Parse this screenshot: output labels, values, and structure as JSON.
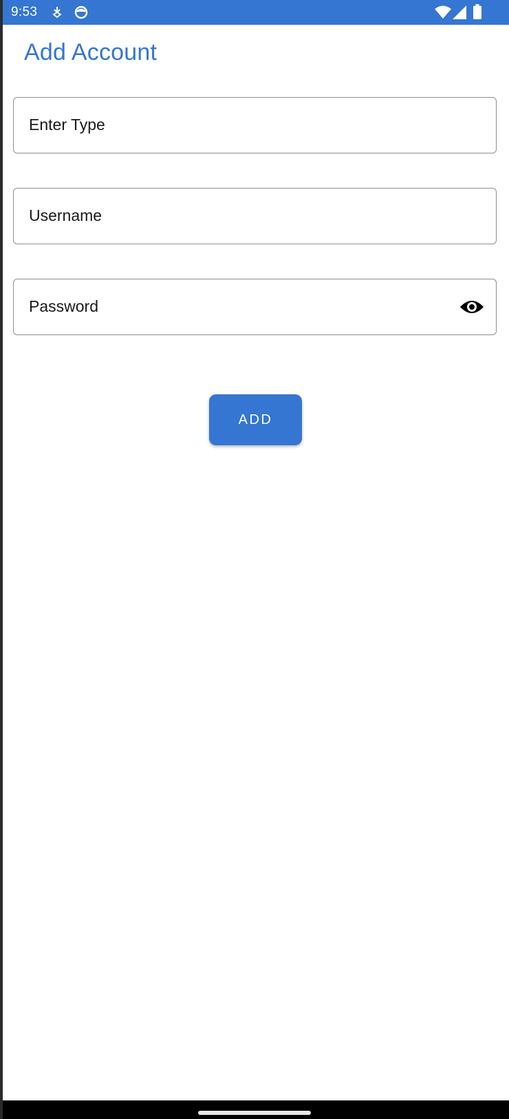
{
  "status_bar": {
    "time": "9:53",
    "icons": [
      "download-notification-icon",
      "app-notification-icon",
      "wifi-icon",
      "signal-icon",
      "battery-icon"
    ],
    "color": "#3476d1"
  },
  "header": {
    "title": "Add Account"
  },
  "form": {
    "type_field": {
      "placeholder": "Enter Type",
      "value": ""
    },
    "username_field": {
      "placeholder": "Username",
      "value": ""
    },
    "password_field": {
      "placeholder": "Password",
      "value": "",
      "toggle_icon": "eye-icon"
    },
    "add_button_label": "ADD"
  },
  "colors": {
    "accent": "#3476d1",
    "field_border": "#8e8e8e",
    "background": "#ffffff"
  }
}
